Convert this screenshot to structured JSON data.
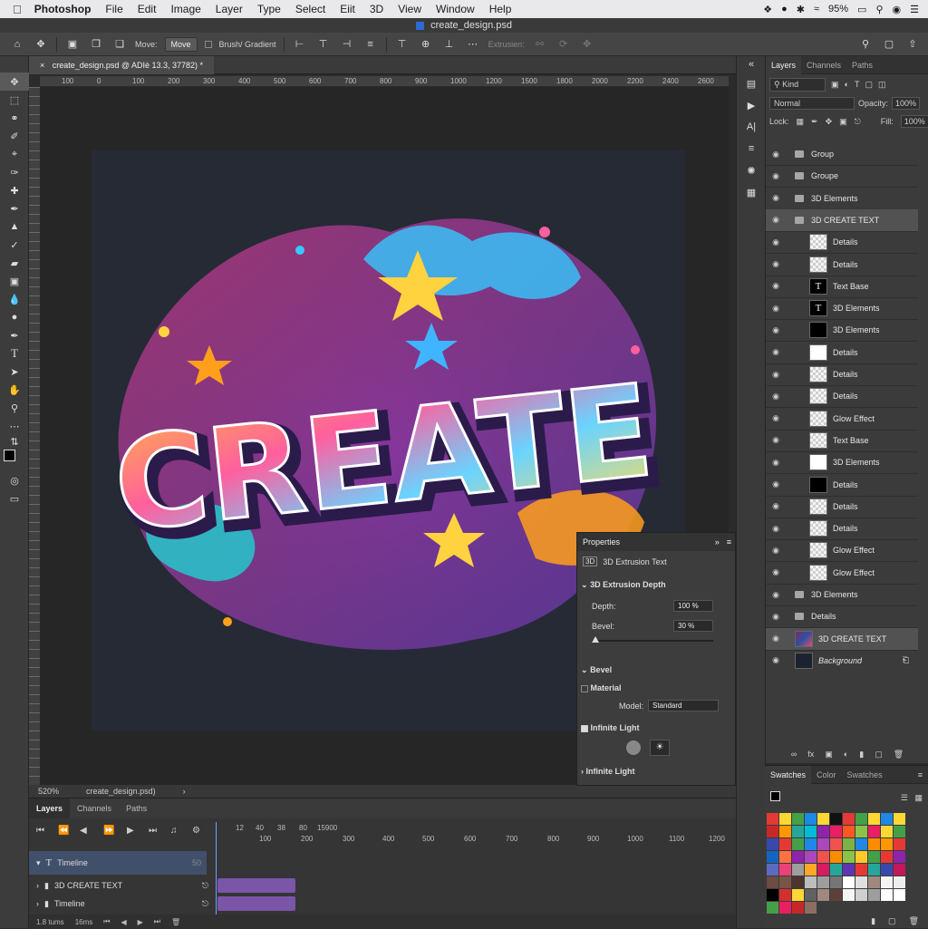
{
  "menubar": {
    "apple_icon": "apple-icon",
    "app_name": "Photoshop",
    "items": [
      "File",
      "Edit",
      "Image",
      "Layer",
      "Type",
      "Select",
      "Eiit",
      "3D",
      "View",
      "Window",
      "Help"
    ],
    "battery": "95%"
  },
  "window": {
    "title": "create_design.psd"
  },
  "options": {
    "move_label": "Move:",
    "move_value": "Move",
    "brush_gradient": "Brush/ Gradient",
    "extrusion": "Extrusien:"
  },
  "document": {
    "tab": "create_design.psd @ ADIè 13.3, 37782) *",
    "ruler_ticks": [
      "100",
      "0",
      "100",
      "200",
      "300",
      "400",
      "500",
      "600",
      "700",
      "800",
      "900",
      "1000",
      "1200",
      "1500",
      "1800",
      "2000",
      "2200",
      "2400",
      "2600"
    ],
    "status_zoom": "520%",
    "status_file": "create_design.psd)",
    "artwork_text": "CREATE"
  },
  "timeline": {
    "tabs": [
      "Layers",
      "Channels",
      "Paths"
    ],
    "ruler": [
      "12",
      "40",
      "38",
      "80",
      "15900",
      "100",
      "200",
      "300",
      "400",
      "500",
      "600",
      "700",
      "800",
      "900",
      "1000",
      "1100",
      "1200"
    ],
    "rows": [
      {
        "label": "Timeline",
        "value": "50"
      },
      {
        "label": "3D CREATE TEXT"
      },
      {
        "label": "Timeline"
      }
    ],
    "footer_left": "1.8 tums",
    "footer_mid": "16ms"
  },
  "layers_panel": {
    "tabs": [
      "Layers",
      "Channels",
      "Paths"
    ],
    "filter": "Kind",
    "blend_mode": "Normal",
    "opacity_label": "Opacity:",
    "opacity": "100%",
    "lock_label": "Lock:",
    "fill_label": "Fill:",
    "fill": "100%",
    "layers": [
      {
        "name": "Group",
        "kind": "folder"
      },
      {
        "name": "Groupe",
        "kind": "folder"
      },
      {
        "name": "3D Elements",
        "kind": "folder"
      },
      {
        "name": "3D CREATE TEXT",
        "kind": "folder"
      },
      {
        "name": "Details",
        "kind": "checker"
      },
      {
        "name": "Details",
        "kind": "checker"
      },
      {
        "name": "Text Base",
        "kind": "type"
      },
      {
        "name": "3D Elements",
        "kind": "type"
      },
      {
        "name": "3D Elements",
        "kind": "black"
      },
      {
        "name": "Details",
        "kind": "white"
      },
      {
        "name": "Details",
        "kind": "checker"
      },
      {
        "name": "Details",
        "kind": "checker"
      },
      {
        "name": "Glow Effect",
        "kind": "checker"
      },
      {
        "name": "Text Base",
        "kind": "checker"
      },
      {
        "name": "3D Elements",
        "kind": "white"
      },
      {
        "name": "Details",
        "kind": "black"
      },
      {
        "name": "Details",
        "kind": "checker"
      },
      {
        "name": "Details",
        "kind": "checker"
      },
      {
        "name": "Glow Effect",
        "kind": "checker"
      },
      {
        "name": "Glow Effect",
        "kind": "checker"
      },
      {
        "name": "3D Elements",
        "kind": "folder"
      },
      {
        "name": "Details",
        "kind": "folder"
      },
      {
        "name": "3D CREATE TEXT",
        "kind": "art"
      },
      {
        "name": "Background",
        "kind": "dark"
      }
    ]
  },
  "properties": {
    "title": "Properties",
    "subtitle": "3D Extrusion Text",
    "section_depth": "3D Extrusion Depth",
    "depth_label": "Depth:",
    "depth": "100 %",
    "bevel_label": "Bevel:",
    "bevel": "30 %",
    "section_bevel": "Bevel",
    "material": "Material",
    "model_label": "Model:",
    "model": "Standard",
    "infinite_light": "Infinite Light",
    "infinite_light_2": "Infinite Light"
  },
  "swatches_panel": {
    "tabs": [
      "Swatches",
      "Color",
      "Swatches"
    ],
    "colors": [
      "#e53935",
      "#fdd835",
      "#43a047",
      "#1e88e5",
      "#fdd835",
      "#111111",
      "#e53935",
      "#43a047",
      "#fdd835",
      "#1e88e5",
      "#fdd835",
      "#c62828",
      "#ff9800",
      "#26a69a",
      "#00bcd4",
      "#8e24aa",
      "#e91e63",
      "#ff5722",
      "#8bc34a",
      "#e91e63",
      "#fdd835",
      "#43a047",
      "#3949ab",
      "#e53935",
      "#43a047",
      "#1e88e5",
      "#ab47bc",
      "#ef5350",
      "#7cb342",
      "#1e88e5",
      "#fb8c00",
      "#ff9800",
      "#e53935",
      "#1565c0",
      "#ff7043",
      "#8e24aa",
      "#ab47bc",
      "#ef5350",
      "#fb8c00",
      "#8bc34a",
      "#ffca28",
      "#43a047",
      "#e53935",
      "#8e24aa",
      "#5c6bc0",
      "#ec407a",
      "#9e9e9e",
      "#ffa726",
      "#d81b60",
      "#26a69a",
      "#5e35b1",
      "#e53935",
      "#26a69a",
      "#3949ab",
      "#c2185b",
      "#6d4c41",
      "#795548",
      "#4e342e",
      "#bdbdbd",
      "#9e9e9e",
      "#757575",
      "#ffffff",
      "#e0e0e0",
      "#a1887f",
      "#f5f5f5",
      "#eeeeee",
      "#000000",
      "#d32f2f",
      "#fdd835",
      "#616161",
      "#a1887f",
      "#5d4037",
      "#f5f5f5",
      "#cfcfcf",
      "#9e9e9e",
      "#ffffff",
      "#ffffff",
      "#43a047",
      "#e91e63",
      "#c62828",
      "#8d6e63"
    ]
  }
}
